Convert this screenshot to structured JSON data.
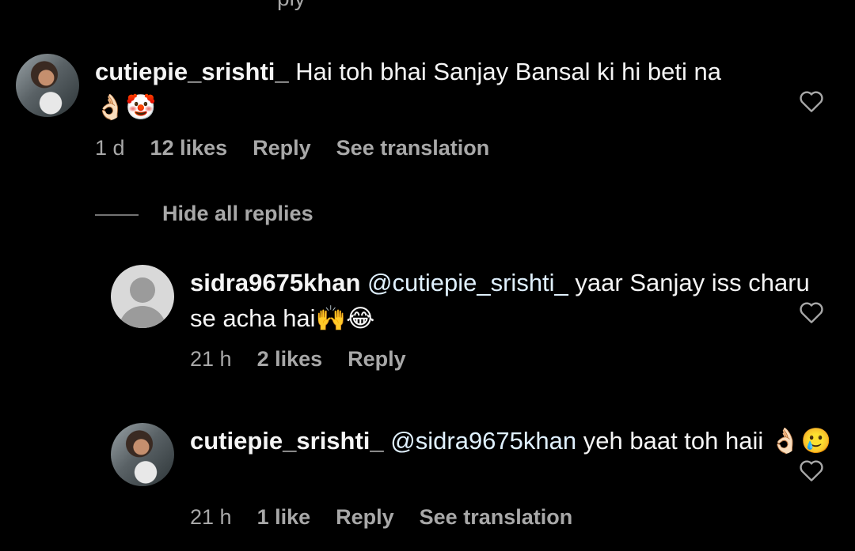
{
  "top_partial": "ply",
  "comments": [
    {
      "username": "cutiepie_srishti_",
      "text_prefix": "",
      "mention": "",
      "text": " Hai toh bhai Sanjay Bansal ki hi beti na",
      "emojis": "👌🏻🤡",
      "time": "1 d",
      "likes": "12 likes",
      "reply": "Reply",
      "translate": "See translation"
    }
  ],
  "hide_replies": "Hide all replies",
  "replies": [
    {
      "username": "sidra9675khan",
      "mention": "@cutiepie_srishti_",
      "text": " yaar Sanjay iss charu se acha hai",
      "emojis": "🙌😂",
      "time": "21 h",
      "likes": "2 likes",
      "reply": "Reply",
      "translate": ""
    },
    {
      "username": "cutiepie_srishti_",
      "mention": "@sidra9675khan",
      "text": " yeh baat toh haii ",
      "emojis": "👌🏻🥲",
      "time": "21 h",
      "likes": "1 like",
      "reply": "Reply",
      "translate": "See translation"
    }
  ],
  "icons": {
    "like": "heart-outline-icon"
  },
  "colors": {
    "background": "#000000",
    "text": "#f5f5f5",
    "secondary": "#a8a8a8"
  }
}
